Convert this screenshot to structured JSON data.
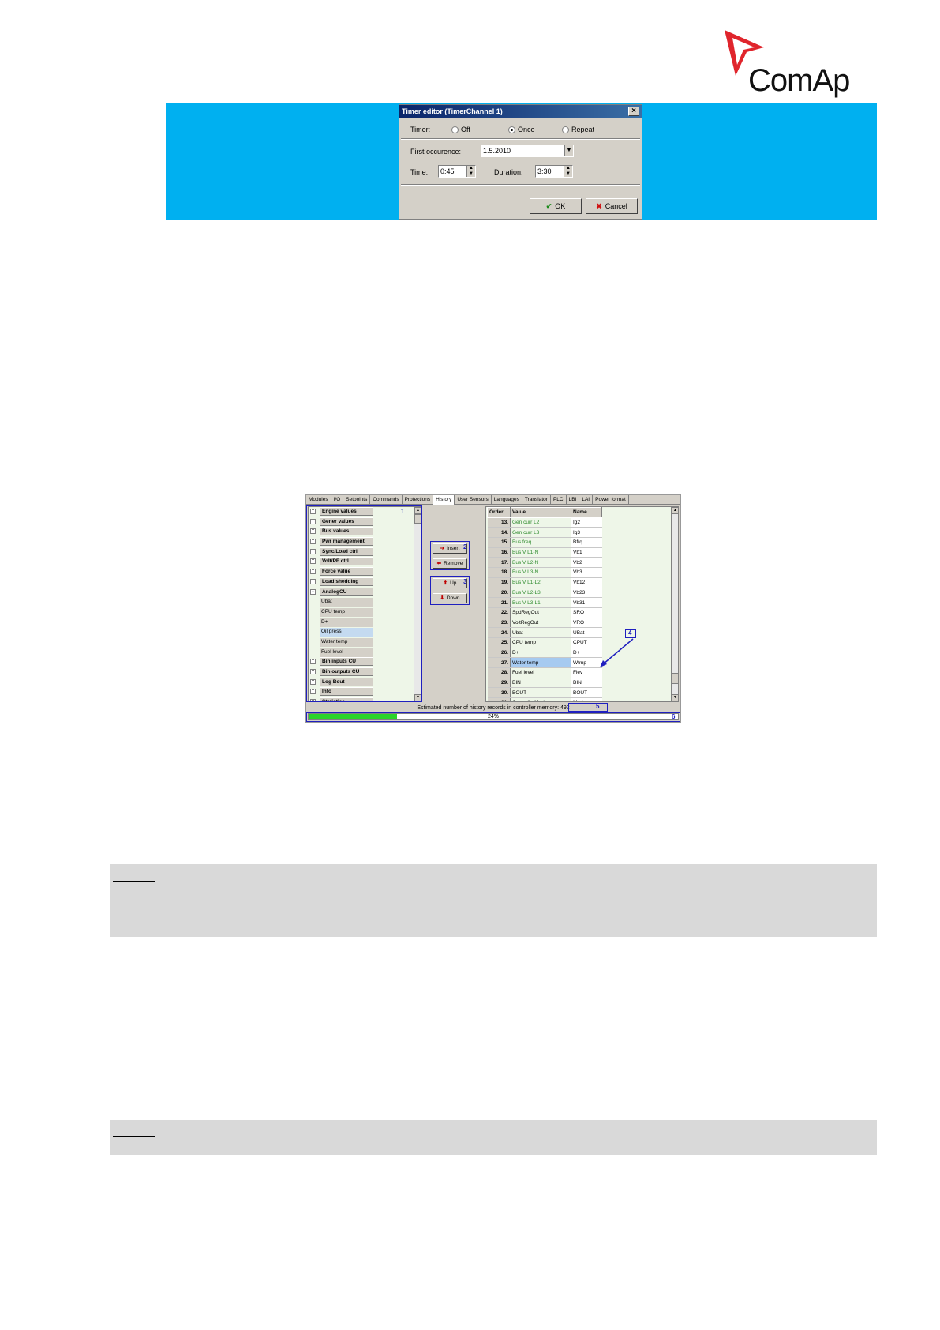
{
  "logo": {
    "text": "ComAp"
  },
  "timer_editor": {
    "title": "Timer editor (TimerChannel 1)",
    "close": "×",
    "timer_label": "Timer:",
    "options": [
      {
        "label": "Off",
        "selected": false
      },
      {
        "label": "Once",
        "selected": true
      },
      {
        "label": "Repeat",
        "selected": false
      }
    ],
    "first_occurence_label": "First occurence:",
    "first_occurence_value": "1.5.2010",
    "time_label": "Time:",
    "time_value": "0:45",
    "duration_label": "Duration:",
    "duration_value": "3:30",
    "ok_label": "OK",
    "cancel_label": "Cancel",
    "ok_icon": "check-icon",
    "cancel_icon": "x-icon"
  },
  "history_tool": {
    "tabs": [
      "Modules",
      "I/O",
      "Setpoints",
      "Commands",
      "Protections",
      "History",
      "User Sensors",
      "Languages",
      "Translator",
      "PLC",
      "LBI",
      "LAI",
      "Power format"
    ],
    "active_tab": "History",
    "tree": [
      {
        "label": "Engine values",
        "sign": "+",
        "sub": false
      },
      {
        "label": "Gener values",
        "sign": "+",
        "sub": false
      },
      {
        "label": "Bus values",
        "sign": "+",
        "sub": false
      },
      {
        "label": "Pwr management",
        "sign": "+",
        "sub": false
      },
      {
        "label": "Sync/Load ctrl",
        "sign": "+",
        "sub": false
      },
      {
        "label": "Volt/PF ctrl",
        "sign": "+",
        "sub": false
      },
      {
        "label": "Force value",
        "sign": "+",
        "sub": false
      },
      {
        "label": "Load shedding",
        "sign": "+",
        "sub": false
      },
      {
        "label": "AnalogCU",
        "sign": "-",
        "sub": false
      },
      {
        "label": "Ubat",
        "sign": "",
        "sub": true
      },
      {
        "label": "CPU temp",
        "sign": "",
        "sub": true
      },
      {
        "label": "D+",
        "sign": "",
        "sub": true
      },
      {
        "label": "Oil press",
        "sign": "",
        "sub": true,
        "selected": true
      },
      {
        "label": "Water temp",
        "sign": "",
        "sub": true
      },
      {
        "label": "Fuel level",
        "sign": "",
        "sub": true
      },
      {
        "label": "Bin inputs CU",
        "sign": "+",
        "sub": false
      },
      {
        "label": "Bin outputs CU",
        "sign": "+",
        "sub": false
      },
      {
        "label": "Log Bout",
        "sign": "+",
        "sub": false
      },
      {
        "label": "Info",
        "sign": "+",
        "sub": false
      },
      {
        "label": "Statistics",
        "sign": "+",
        "sub": false
      }
    ],
    "buttons": {
      "insert": "Insert",
      "remove": "Remove",
      "up": "Up",
      "down": "Down"
    },
    "table_headers": {
      "order": "Order",
      "value": "Value",
      "name": "Name"
    },
    "rows": [
      {
        "order": "13.",
        "value": "Gen curr L2",
        "name": "Ig2",
        "green": true
      },
      {
        "order": "14.",
        "value": "Gen curr L3",
        "name": "Ig3",
        "green": true
      },
      {
        "order": "15.",
        "value": "Bus freq",
        "name": "Bfrq",
        "green": true
      },
      {
        "order": "16.",
        "value": "Bus V L1-N",
        "name": "Vb1",
        "green": true
      },
      {
        "order": "17.",
        "value": "Bus V L2-N",
        "name": "Vb2",
        "green": true
      },
      {
        "order": "18.",
        "value": "Bus V L3-N",
        "name": "Vb3",
        "green": true
      },
      {
        "order": "19.",
        "value": "Bus V L1-L2",
        "name": "Vb12",
        "green": true
      },
      {
        "order": "20.",
        "value": "Bus V L2-L3",
        "name": "Vb23",
        "green": true
      },
      {
        "order": "21.",
        "value": "Bus V L3-L1",
        "name": "Vb31",
        "green": true
      },
      {
        "order": "22.",
        "value": "SpdRegOut",
        "name": "SRO",
        "green": false
      },
      {
        "order": "23.",
        "value": "VoltRegOut",
        "name": "VRO",
        "green": false
      },
      {
        "order": "24.",
        "value": "Ubat",
        "name": "UBat",
        "green": false
      },
      {
        "order": "25.",
        "value": "CPU temp",
        "name": "CPUT",
        "green": false
      },
      {
        "order": "26.",
        "value": "D+",
        "name": "D+",
        "green": false
      },
      {
        "order": "27.",
        "value": "Water temp",
        "name": "Wtmp",
        "green": false,
        "selected": true
      },
      {
        "order": "28.",
        "value": "Fuel level",
        "name": "Flev",
        "green": false
      },
      {
        "order": "29.",
        "value": "BIN",
        "name": "BIN",
        "green": false
      },
      {
        "order": "30.",
        "value": "BOUT",
        "name": "BOUT",
        "green": false
      },
      {
        "order": "31.",
        "value": "ControllerMode",
        "name": "Mode",
        "green": false
      }
    ],
    "status_label": "Estimated number of history records in controller memory:",
    "status_value": "492",
    "progress_text": "24%",
    "progress_fraction": 0.24,
    "callouts": [
      "1",
      "2",
      "3",
      "4",
      "5",
      "6"
    ]
  },
  "colors": {
    "banner": "#00b0f0",
    "callout": "#1f1fbf",
    "note_bg": "#d9d9d9",
    "logo_red": "#e0252c"
  }
}
